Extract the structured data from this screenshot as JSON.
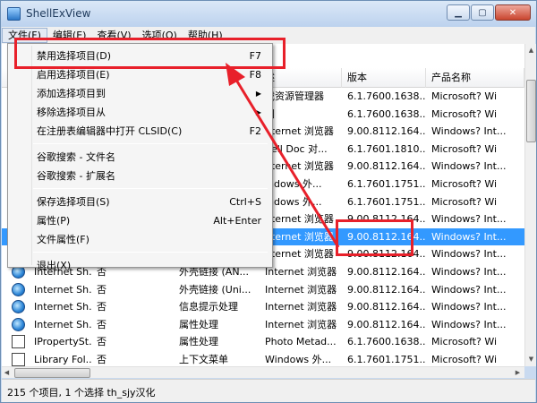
{
  "window": {
    "title": "ShellExView"
  },
  "menubar": [
    {
      "label": "文件(F)"
    },
    {
      "label": "编辑(E)"
    },
    {
      "label": "查看(V)"
    },
    {
      "label": "选项(O)"
    },
    {
      "label": "帮助(H)"
    }
  ],
  "columns": [
    "述",
    "版本",
    "产品名称"
  ],
  "rows": [
    {
      "name": "",
      "flag": "",
      "type": "",
      "desc": "戏资源管理器",
      "version": "6.1.7600.1638...",
      "product": "Microsoft? Wi",
      "icon": "none"
    },
    {
      "name": "",
      "flag": "",
      "type": "",
      "desc": "门",
      "version": "6.1.7600.1638...",
      "product": "Microsoft? Wi",
      "icon": "none"
    },
    {
      "name": "",
      "flag": "",
      "type": "",
      "desc": "nternet 浏览器",
      "version": "9.00.8112.164...",
      "product": "Windows? Int...",
      "icon": "none"
    },
    {
      "name": "",
      "flag": "",
      "type": "",
      "desc": "hell Doc 对...",
      "version": "6.1.7601.1810...",
      "product": "Microsoft? Wi",
      "icon": "none"
    },
    {
      "name": "",
      "flag": "",
      "type": "",
      "desc": "nternet 浏览器",
      "version": "9.00.8112.164...",
      "product": "Windows? Int...",
      "icon": "none"
    },
    {
      "name": "",
      "flag": "",
      "type": "",
      "desc": "indows 外...",
      "version": "6.1.7601.1751...",
      "product": "Microsoft? Wi",
      "icon": "none"
    },
    {
      "name": "",
      "flag": "",
      "type": "",
      "desc": "indows 外...",
      "version": "6.1.7601.1751...",
      "product": "Microsoft? Wi",
      "icon": "none"
    },
    {
      "name": "",
      "flag": "",
      "type": "",
      "desc": "nternet 浏览器",
      "version": "9.00.8112.164...",
      "product": "Windows? Int...",
      "icon": "none"
    },
    {
      "name": "",
      "flag": "",
      "type": "",
      "desc": "nternet 浏览器",
      "version": "9.00.8112.164...",
      "product": "Windows? Int...",
      "icon": "none",
      "selected": true
    },
    {
      "name": "",
      "flag": "",
      "type": "",
      "desc": "nternet 浏览器",
      "version": "9.00.8112.164...",
      "product": "Windows? Int...",
      "icon": "none"
    },
    {
      "name": "Internet Sh...",
      "flag": "否",
      "type": "外壳链接 (AN...",
      "desc": "Internet 浏览器",
      "version": "9.00.8112.164...",
      "product": "Windows? Int...",
      "icon": "ie"
    },
    {
      "name": "Internet Sh...",
      "flag": "否",
      "type": "外壳链接 (Uni...",
      "desc": "Internet 浏览器",
      "version": "9.00.8112.164...",
      "product": "Windows? Int...",
      "icon": "ie"
    },
    {
      "name": "Internet Sh...",
      "flag": "否",
      "type": "信息提示处理",
      "desc": "Internet 浏览器",
      "version": "9.00.8112.164...",
      "product": "Windows? Int...",
      "icon": "ie"
    },
    {
      "name": "Internet Sh...",
      "flag": "否",
      "type": "属性处理",
      "desc": "Internet 浏览器",
      "version": "9.00.8112.164...",
      "product": "Windows? Int...",
      "icon": "ie"
    },
    {
      "name": "IPropertySt...",
      "flag": "否",
      "type": "属性处理",
      "desc": "Photo Metad...",
      "version": "6.1.7600.1638...",
      "product": "Microsoft? Wi",
      "icon": "doc"
    },
    {
      "name": "Library Fol...",
      "flag": "否",
      "type": "上下文菜单",
      "desc": "Windows 外...",
      "version": "6.1.7601.1751...",
      "product": "Microsoft? Wi",
      "icon": "doc"
    }
  ],
  "dropdown": [
    {
      "kind": "item",
      "label": "禁用选择项目(D)",
      "shortcut": "F7"
    },
    {
      "kind": "item",
      "label": "启用选择项目(E)",
      "shortcut": "F8"
    },
    {
      "kind": "item",
      "label": "添加选择项目到",
      "submenu": true
    },
    {
      "kind": "item",
      "label": "移除选择项目从",
      "submenu": true
    },
    {
      "kind": "item",
      "label": "在注册表编辑器中打开 CLSID(C)",
      "shortcut": "F2"
    },
    {
      "kind": "sep"
    },
    {
      "kind": "item",
      "label": "谷歌搜索 - 文件名"
    },
    {
      "kind": "item",
      "label": "谷歌搜索 - 扩展名"
    },
    {
      "kind": "sep"
    },
    {
      "kind": "item",
      "label": "保存选择项目(S)",
      "shortcut": "Ctrl+S"
    },
    {
      "kind": "item",
      "label": "属性(P)",
      "shortcut": "Alt+Enter"
    },
    {
      "kind": "item",
      "label": "文件属性(F)"
    },
    {
      "kind": "sep"
    },
    {
      "kind": "item",
      "label": "退出(X)"
    }
  ],
  "status": "215 个项目, 1 个选择    th_sjy汉化",
  "colors": {
    "selection": "#3399ff",
    "highlight": "#e8202a"
  }
}
